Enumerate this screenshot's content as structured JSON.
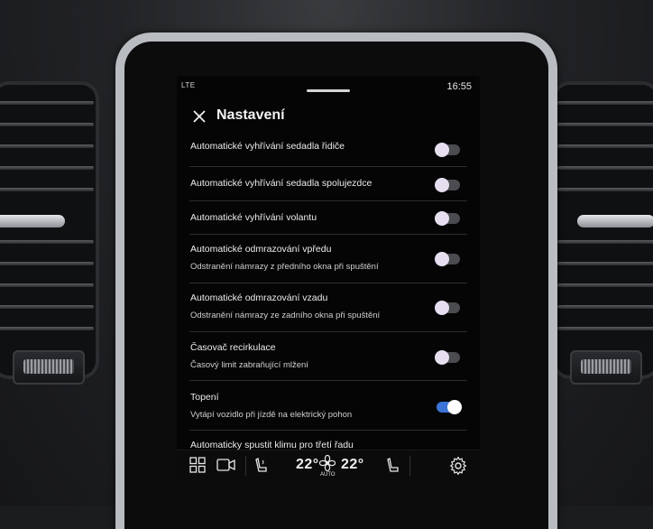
{
  "status": {
    "network": "LTE",
    "time": "16:55"
  },
  "header": {
    "title": "Nastavení"
  },
  "settings": [
    {
      "label": "Automatické vyhřívání sedadla řidiče",
      "sublabel": "",
      "on": false
    },
    {
      "label": "Automatické vyhřívání sedadla spolujezdce",
      "sublabel": "",
      "on": false
    },
    {
      "label": "Automatické vyhřívání volantu",
      "sublabel": "",
      "on": false
    },
    {
      "label": "Automatické odmrazování vpředu",
      "sublabel": "Odstranění námrazy z předního okna při spuštění",
      "on": false
    },
    {
      "label": "Automatické odmrazování vzadu",
      "sublabel": "Odstranění námrazy ze zadního okna při spuštění",
      "on": false
    },
    {
      "label": "Časovač recirkulace",
      "sublabel": "Časový limit zabraňující mlžení",
      "on": false
    },
    {
      "label": "Topení",
      "sublabel": "Vytápí vozidlo při jízdě na elektrický pohon",
      "on": true
    },
    {
      "label": "Automaticky spustit klimu pro třetí řadu",
      "sublabel": "",
      "on": false
    }
  ],
  "climate_bar": {
    "left_temp": "22°",
    "right_temp": "22°",
    "fan_mode": "AUTO"
  },
  "colors": {
    "toggle_on": "#3b74d6",
    "toggle_off": "#4b4c50",
    "screen_bg": "#050506"
  },
  "icons": {
    "close": "close-icon",
    "apps": "app-grid-icon",
    "camera": "camera-icon",
    "driver_seat": "driver-seat-icon",
    "fan": "fan-icon",
    "passenger_seat": "passenger-seat-icon",
    "settings": "gear-icon"
  }
}
